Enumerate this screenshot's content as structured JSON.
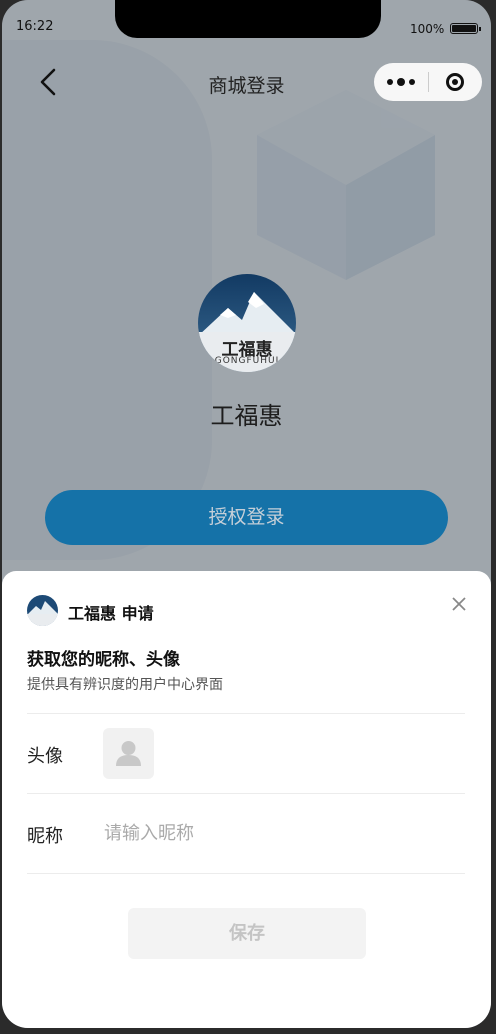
{
  "status_bar": {
    "time": "16:22",
    "battery": "100%"
  },
  "nav": {
    "title": "商城登录"
  },
  "shop": {
    "name": "工福惠",
    "logo_text": "工福惠",
    "logo_subtext": "GONGFUHUI"
  },
  "auth_button": {
    "label": "授权登录"
  },
  "sheet": {
    "app_name": "工福惠 申请",
    "title": "获取您的昵称、头像",
    "description": "提供具有辨识度的用户中心界面",
    "avatar_label": "头像",
    "nickname_label": "昵称",
    "nickname_placeholder": "请输入昵称",
    "save_label": "保存"
  },
  "colors": {
    "primary": "#1572a8",
    "sheet_bg": "#ffffff",
    "page_bg": "#dde6ef"
  }
}
